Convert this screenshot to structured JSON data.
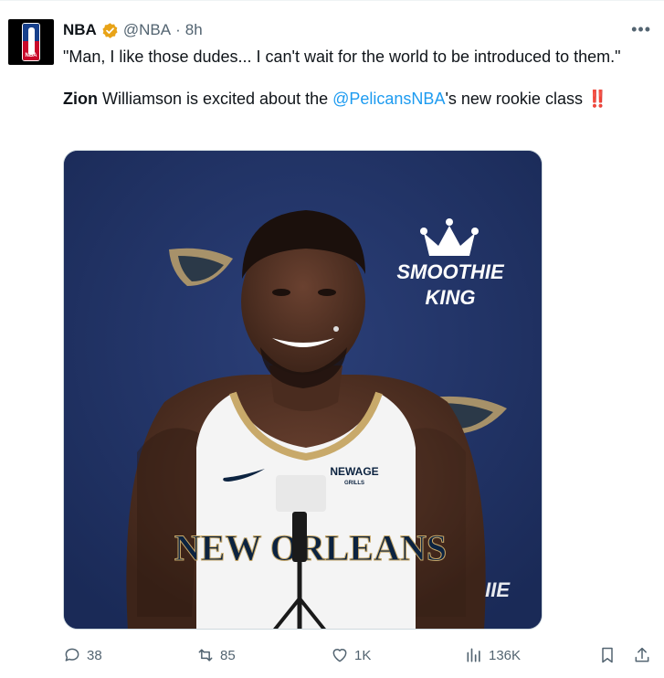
{
  "author": {
    "name": "NBA",
    "handle": "@NBA",
    "separator": "·",
    "time": "8h",
    "avatar_icon": "nba-logo-icon",
    "avatar_logo_text": "NBA"
  },
  "tweet": {
    "line1": "\"Man, I like those dudes... I can't wait for the world to be introduced to them.\"",
    "line2_bold": "Zion",
    "line2_middle": " Williamson is excited about the ",
    "line2_mention": "@PelicansNBA",
    "line2_end": "'s new rookie class ",
    "emoji": "‼️"
  },
  "media": {
    "sponsor_line1": "SMOOTHIE",
    "sponsor_line2": "KING",
    "jersey_sponsor": "NEWAGE",
    "jersey_sponsor_sub": "GRILLS",
    "jersey_text": "NEW ORLEANS",
    "partial_text": "IIE"
  },
  "actions": {
    "replies": "38",
    "reposts": "85",
    "likes": "1K",
    "views": "136K"
  },
  "colors": {
    "accent": "#1d9bf0",
    "verified": "#e8a317",
    "muted": "#536471",
    "backdrop": "#1f3163"
  }
}
